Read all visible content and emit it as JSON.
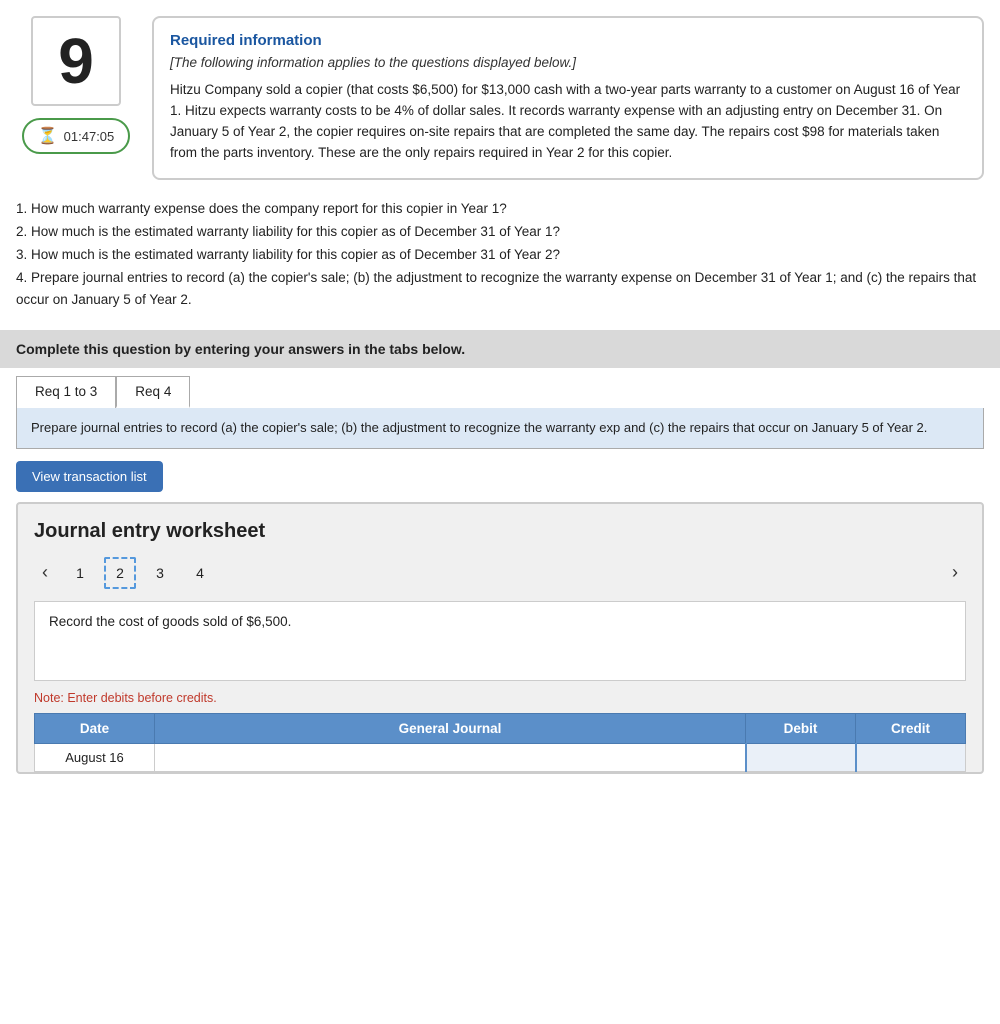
{
  "question_number": "9",
  "timer": "01:47:05",
  "info": {
    "title": "Required information",
    "subtitle": "[The following information applies to the questions displayed below.]",
    "body": "Hitzu Company sold a copier (that costs $6,500) for $13,000 cash with a two-year parts warranty to a customer on August 16 of Year 1. Hitzu expects warranty costs to be 4% of dollar sales. It records warranty expense with an adjusting entry on December 31. On January 5 of Year 2, the copier requires on-site repairs that are completed the same day. The repairs cost $98 for materials taken from the parts inventory. These are the only repairs required in Year 2 for this copier."
  },
  "questions": [
    "1. How much warranty expense does the company report for this copier in Year 1?",
    "2. How much is the estimated warranty liability for this copier as of December 31 of Year 1?",
    "3. How much is the estimated warranty liability for this copier as of December 31 of Year 2?",
    "4. Prepare journal entries to record (a) the copier's sale; (b) the adjustment to recognize the warranty expense on December 31 of Year 1; and (c) the repairs that occur on January 5 of Year 2."
  ],
  "complete_banner": "Complete this question by entering your answers in the tabs below.",
  "tabs": [
    {
      "id": "req1to3",
      "label": "Req 1 to 3"
    },
    {
      "id": "req4",
      "label": "Req 4"
    }
  ],
  "active_tab": "req4",
  "tab_content": "Prepare journal entries to record (a) the copier's sale; (b) the adjustment to recognize the warranty exp and (c) the repairs that occur on January 5 of Year 2.",
  "view_btn_label": "View transaction list",
  "worksheet": {
    "title": "Journal entry worksheet",
    "pages": [
      "1",
      "2",
      "3",
      "4"
    ],
    "active_page": "2",
    "record_text": "Record the cost of goods sold of $6,500.",
    "note": "Note: Enter debits before credits.",
    "table": {
      "headers": [
        "Date",
        "General Journal",
        "Debit",
        "Credit"
      ],
      "rows": [
        {
          "date": "August 16",
          "general_journal": "",
          "debit": "",
          "credit": ""
        }
      ]
    }
  }
}
